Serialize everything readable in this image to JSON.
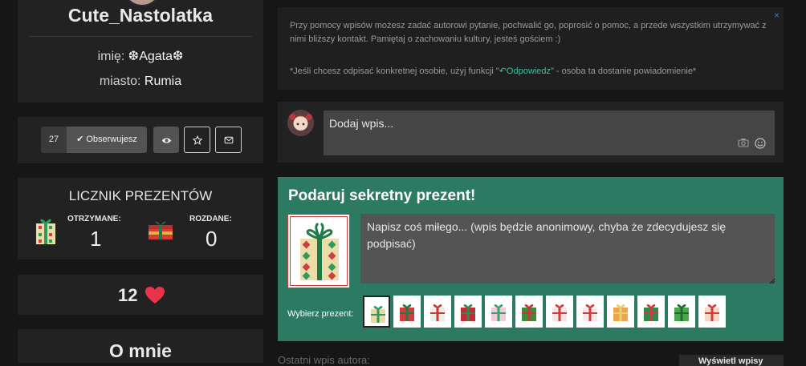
{
  "profile": {
    "username": "Cute_Nastolatka",
    "name_label": "imię:",
    "name_value": "❆Agata❆",
    "city_label": "miasto:",
    "city_value": "Rumia"
  },
  "actions": {
    "followers_count": "27",
    "follow_label": "Obserwujesz",
    "icons": [
      "check-icon",
      "eye-icon",
      "star-icon",
      "envelope-icon"
    ]
  },
  "gifts": {
    "title": "LICZNIK PREZENTÓW",
    "received_label": "OTRZYMANE:",
    "received_count": "1",
    "given_label": "ROZDANE:",
    "given_count": "0"
  },
  "likes": {
    "count": "12",
    "heart_color": "#e8334a"
  },
  "about": {
    "title": "O mnie"
  },
  "notice": {
    "text1": "Przy pomocy wpisów możesz zadać autorowi pytanie, pochwalić go, poprosić o pomoc, a przede wszystkim utrzymywać z nimi bliższy kontakt. Pamiętaj o zachowaniu kultury, jesteś gościem :)",
    "text2_before": "*Jeśli chcesz odpisać konkretnej osobie, użyj funkcji \"",
    "reply_link": "Odpowiedz",
    "text2_after": "\" - osoba ta dostanie powiadomienie*",
    "close_symbol": "×"
  },
  "post_box": {
    "placeholder": "Dodaj wpis..."
  },
  "secret_gift": {
    "title": "Podaruj sekretny prezent!",
    "message_placeholder": "Napisz coś miłego... (wpis będzie anonimowy, chyba że zdecydujesz się podpisać)",
    "choose_label": "Wybierz prezent:",
    "panel_color": "#2d7a63",
    "options": [
      {
        "name": "gift-checkered-green-bow",
        "box": "#e9d9a6",
        "accent": "#2e9a5e"
      },
      {
        "name": "gift-red-green-ribbon",
        "box": "#d63b3b",
        "accent": "#1f7a46"
      },
      {
        "name": "gift-white-polka",
        "box": "#e8efe6",
        "accent": "#c93737"
      },
      {
        "name": "gift-red-dotted",
        "box": "#c8283a",
        "accent": "#2f8a4f"
      },
      {
        "name": "gift-pink-checkered",
        "box": "#f3c9dd",
        "accent": "#3aa16a"
      },
      {
        "name": "gift-green-striped",
        "box": "#3f8a3f",
        "accent": "#c93737"
      },
      {
        "name": "gift-white-red-dots",
        "box": "#f0e6e6",
        "accent": "#d03b3b"
      },
      {
        "name": "gift-white-red-bow",
        "box": "#f3eaea",
        "accent": "#d03b3b"
      },
      {
        "name": "gift-orange-checkered",
        "box": "#f0a44a",
        "accent": "#e3d27a"
      },
      {
        "name": "gift-green-red-ribbon",
        "box": "#2f8a4f",
        "accent": "#d03b3b"
      },
      {
        "name": "gift-green-tall",
        "box": "#4aa84a",
        "accent": "#1f6a30"
      },
      {
        "name": "gift-peach-red-ribbon",
        "box": "#f4d9c4",
        "accent": "#d03b3b"
      }
    ]
  },
  "last_post": {
    "label": "Ostatni wpis autora:",
    "button_label": "Wyświetl wpisy"
  }
}
